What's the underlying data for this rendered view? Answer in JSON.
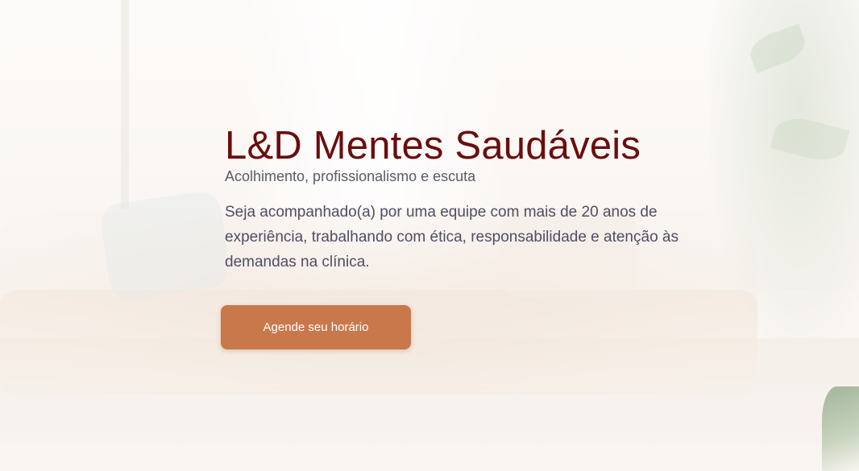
{
  "hero": {
    "title": "L&D Mentes Saudáveis",
    "subtitle": "Acolhimento, profissionalismo e escuta",
    "description": "Seja acompanhado(a) por uma equipe com mais de 20 anos de experiência, trabalhando com ética, responsabilidade e atenção às demandas na clínica.",
    "cta_label": "Agende seu horário"
  },
  "colors": {
    "title": "#6b0d0d",
    "text": "#4e4e66",
    "cta_background": "#c8784a",
    "cta_text": "#ffffff"
  }
}
